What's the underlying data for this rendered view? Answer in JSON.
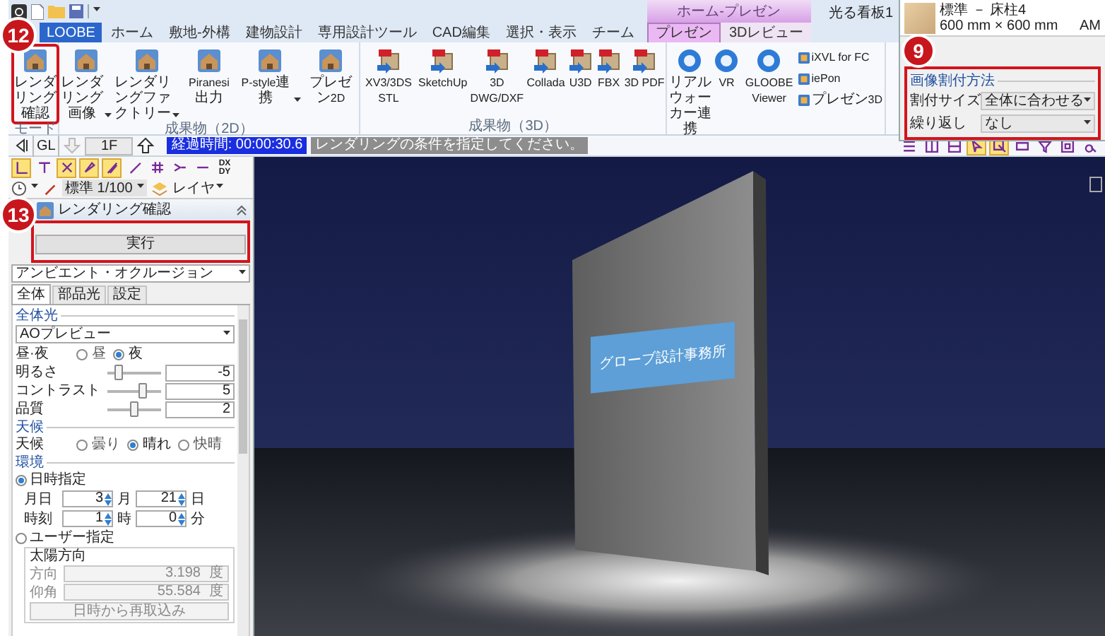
{
  "title_bar": {
    "title": "光る看板1"
  },
  "contextual_group": {
    "label": "ホーム-プレゼン"
  },
  "tabs": [
    {
      "label": "LOOBE",
      "kind": "file",
      "selected": false
    },
    {
      "label": "ホーム",
      "kind": "normal",
      "selected": false
    },
    {
      "label": "敷地-外構",
      "kind": "normal",
      "selected": false
    },
    {
      "label": "建物設計",
      "kind": "normal",
      "selected": false
    },
    {
      "label": "専用設計ツール",
      "kind": "normal",
      "selected": false
    },
    {
      "label": "CAD編集",
      "kind": "normal",
      "selected": false
    },
    {
      "label": "選択・表示",
      "kind": "normal",
      "selected": false
    },
    {
      "label": "チーム",
      "kind": "normal",
      "selected": false
    },
    {
      "label": "プレゼン",
      "kind": "contextual",
      "selected": true
    },
    {
      "label": "3Dレビュー",
      "kind": "contextual",
      "selected": false
    }
  ],
  "ribbon": {
    "groups": [
      {
        "label": "モード",
        "items": [
          {
            "label": "レンダリング確認",
            "kind": "large",
            "dropdown": false,
            "highlighted": true
          }
        ]
      },
      {
        "label": "成果物（2D）",
        "items": [
          {
            "label": "レンダリング画像",
            "kind": "large",
            "dropdown": true,
            "highlighted": false
          },
          {
            "label": "レンダリングファクトリー",
            "kind": "large",
            "dropdown": true,
            "highlighted": false
          },
          {
            "label": "Piranesi出力",
            "kind": "large",
            "dropdown": false,
            "highlighted": false
          },
          {
            "label": "P-style連携",
            "kind": "large",
            "dropdown": true,
            "highlighted": false
          },
          {
            "label": "プレゼン2D",
            "kind": "large",
            "dropdown": false,
            "highlighted": false
          }
        ]
      },
      {
        "label": "成果物（3D）",
        "items": [
          {
            "label": "XV3/3DS STL",
            "kind": "large",
            "dropdown": false,
            "highlighted": false
          },
          {
            "label": "SketchUp",
            "kind": "large",
            "dropdown": false,
            "highlighted": false
          },
          {
            "label": "3D DWG/DXF",
            "kind": "large",
            "dropdown": false,
            "highlighted": false
          },
          {
            "label": "Collada",
            "kind": "large",
            "dropdown": false,
            "highlighted": false
          },
          {
            "label": "U3D",
            "kind": "large",
            "dropdown": false,
            "highlighted": false
          },
          {
            "label": "FBX",
            "kind": "large",
            "dropdown": false,
            "highlighted": false
          },
          {
            "label": "3D PDF",
            "kind": "large",
            "dropdown": false,
            "highlighted": false
          }
        ]
      },
      {
        "items": [
          {
            "label": "リアルウォーカー連携",
            "kind": "large",
            "dropdown": false,
            "highlighted": false
          },
          {
            "label": "VR",
            "kind": "large",
            "dropdown": false,
            "highlighted": false
          },
          {
            "label": "GLOOBE Viewer",
            "kind": "large",
            "dropdown": false,
            "highlighted": false
          },
          {
            "label": "iXVL for FC",
            "kind": "small",
            "dropdown": false,
            "highlighted": false
          },
          {
            "label": "iePon",
            "kind": "small",
            "dropdown": false,
            "highlighted": false
          },
          {
            "label": "プレゼン3D",
            "kind": "small",
            "dropdown": false,
            "highlighted": false
          }
        ]
      }
    ]
  },
  "toolbar": {
    "level": "GL",
    "floor": "1F",
    "elapsed": "経過時間: 00:00:30.6",
    "message": "レンダリングの条件を指定してください。",
    "view_tools": [
      {
        "active": false
      },
      {
        "active": false
      },
      {
        "active": false
      },
      {
        "active": true
      },
      {
        "active": true
      },
      {
        "active": false
      },
      {
        "active": false
      },
      {
        "active": false
      },
      {
        "active": false
      }
    ]
  },
  "draw_tools": [
    {
      "kind": "tool",
      "active": true
    },
    {
      "kind": "tool",
      "active": false
    },
    {
      "kind": "tool",
      "active": true
    },
    {
      "kind": "tool",
      "active": true
    },
    {
      "kind": "tool",
      "active": true
    },
    {
      "kind": "tool",
      "active": false
    },
    {
      "kind": "tool",
      "active": false
    },
    {
      "kind": "tool",
      "active": false
    },
    {
      "kind": "tool",
      "active": false
    },
    {
      "kind": "label",
      "text": "DX DY"
    }
  ],
  "settings_bar": {
    "scale": "標準 1/100",
    "layer": "レイヤ"
  },
  "panel": {
    "title": "レンダリング確認",
    "execute": "実行",
    "highlighted": true,
    "mode": "アンビエント・オクルージョン",
    "tabs": [
      {
        "label": "全体",
        "selected": true
      },
      {
        "label": "部品光",
        "selected": false
      },
      {
        "label": "設定",
        "selected": false
      }
    ],
    "sections": [
      {
        "title": "全体光",
        "rows": [
          {
            "kind": "dropdown",
            "value": "AOプレビュー"
          },
          {
            "kind": "radios",
            "label": "昼·夜",
            "options": [
              {
                "label": "昼",
                "selected": false
              },
              {
                "label": "夜",
                "selected": true
              }
            ]
          },
          {
            "kind": "slider",
            "label": "明るさ",
            "level": 0.2,
            "value": "-5"
          },
          {
            "kind": "slider",
            "label": "コントラスト",
            "level": 0.65,
            "value": "5"
          },
          {
            "kind": "slider",
            "label": "品質",
            "level": 0.5,
            "value": "2"
          }
        ]
      },
      {
        "title": "天候",
        "rows": [
          {
            "kind": "radios",
            "label": "天候",
            "options": [
              {
                "label": "曇り",
                "selected": false
              },
              {
                "label": "晴れ",
                "selected": true
              },
              {
                "label": "快晴",
                "selected": false
              }
            ]
          }
        ]
      },
      {
        "title": "環境",
        "rows": [
          {
            "kind": "option",
            "label": "日時指定",
            "selected": true
          },
          {
            "kind": "spinners",
            "label": "月日",
            "fields": [
              {
                "value": "3",
                "unit": "月"
              },
              {
                "value": "21",
                "unit": "日"
              }
            ]
          },
          {
            "kind": "spinners",
            "label": "時刻",
            "fields": [
              {
                "value": "1",
                "unit": "時"
              },
              {
                "value": "0",
                "unit": "分"
              }
            ]
          },
          {
            "kind": "option",
            "label": "ユーザー指定",
            "selected": false
          },
          {
            "kind": "fieldset",
            "title": "太陽方向",
            "fields": [
              {
                "label": "方向",
                "value": "3.198",
                "unit": "度",
                "disabled": true
              },
              {
                "label": "仰角",
                "value": "55.584",
                "unit": "度",
                "disabled": true
              }
            ],
            "button": {
              "label": "日時から再取込み",
              "disabled": true
            }
          }
        ]
      }
    ]
  },
  "viewport": {
    "sign_text": "グローブ設計事務所"
  },
  "material_dialog": {
    "name": "標準 － 床柱4",
    "size": "600 mm × 600 mm",
    "code": "AM",
    "mapping": {
      "title": "画像割付方法",
      "highlighted": true,
      "fields": [
        {
          "label": "割付サイズ",
          "value": "全体に合わせる"
        },
        {
          "label": "繰り返し",
          "value": "なし"
        }
      ]
    }
  },
  "callouts": [
    {
      "number": "12"
    },
    {
      "number": "9"
    },
    {
      "number": "13"
    }
  ]
}
